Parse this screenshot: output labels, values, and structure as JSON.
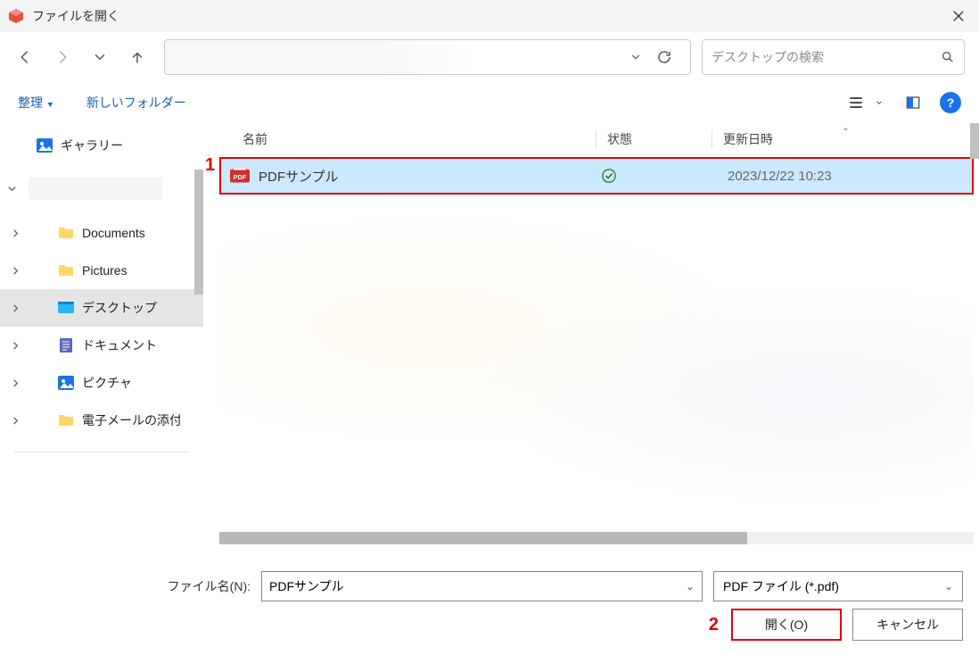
{
  "title": "ファイルを開く",
  "search": {
    "placeholder": "デスクトップの検索"
  },
  "toolbar": {
    "organize": "整理",
    "new_folder": "新しいフォルダー"
  },
  "sidebar": {
    "gallery": "ギャラリー",
    "items": [
      {
        "label": "Documents"
      },
      {
        "label": "Pictures"
      },
      {
        "label": "デスクトップ"
      },
      {
        "label": "ドキュメント"
      },
      {
        "label": "ピクチャ"
      },
      {
        "label": "電子メールの添付"
      }
    ]
  },
  "columns": {
    "name": "名前",
    "status": "状態",
    "date": "更新日時"
  },
  "files": [
    {
      "name": "PDFサンプル",
      "date": "2023/12/22 10:23"
    }
  ],
  "footer": {
    "filename_label": "ファイル名(N):",
    "filename_value": "PDFサンプル",
    "filter": "PDF ファイル (*.pdf)",
    "open": "開く(O)",
    "cancel": "キャンセル"
  },
  "annotations": {
    "a1": "1",
    "a2": "2"
  }
}
